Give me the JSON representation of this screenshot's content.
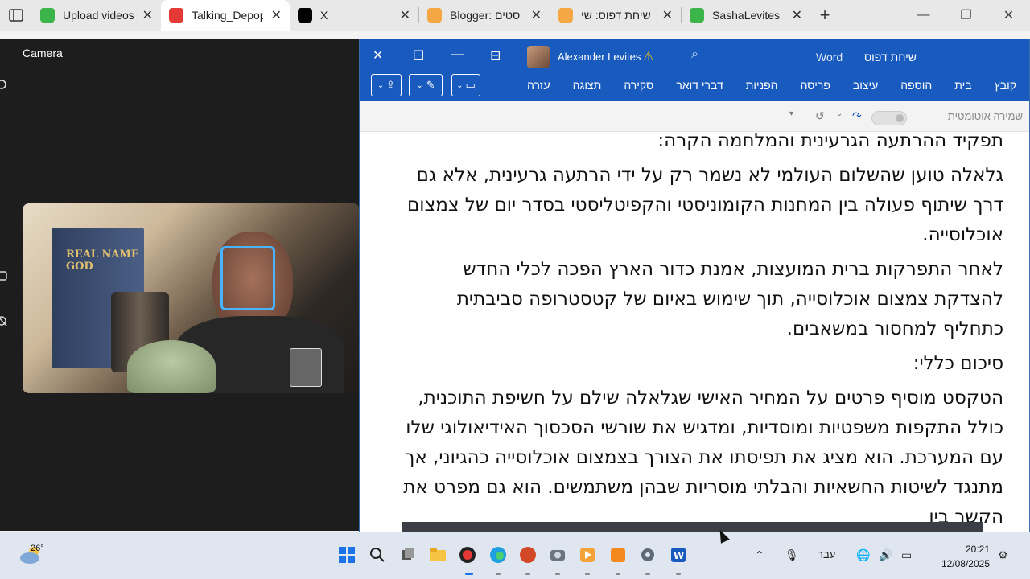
{
  "browser": {
    "tabs": [
      {
        "label": "Upload videos",
        "color": "#3bb54a"
      },
      {
        "label": "Talking_Depop",
        "color": "#e53935"
      },
      {
        "label": "X",
        "color": "#000000"
      },
      {
        "label": "Blogger: סטים",
        "color": "#f4a742"
      },
      {
        "label": "שיחת דפוס: שי",
        "color": "#f4a742"
      },
      {
        "label": "SashaLevites",
        "color": "#3bb54a"
      }
    ],
    "new_tab_label": "+"
  },
  "camera": {
    "title": "Camera",
    "book_text": "REAL NAME GOD"
  },
  "word": {
    "user_name": "Alexander Levites",
    "app_name": "Word",
    "doc_title": "שיחת דפוס",
    "ribbon_tabs": [
      "קובץ",
      "בית",
      "הוספה",
      "עיצוב",
      "פריסה",
      "הפניות",
      "דברי דואר",
      "סקירה",
      "תצוגה",
      "עזרה"
    ],
    "autosave_label": "שמירה אוטומטית",
    "document": {
      "paragraphs": [
        "תפקיד ההרתעה הגרעינית והמלחמה הקרה:",
        "גלאלה טוען שהשלום העולמי לא נשמר רק על ידי הרתעה גרעינית, אלא גם דרך שיתוף פעולה בין המחנות הקומוניסטי והקפיטליסטי בסדר יום של צמצום אוכלוסייה.",
        "לאחר התפרקות ברית המועצות, אמנת כדור הארץ הפכה לכלי החדש להצדקת צמצום אוכלוסייה, תוך שימוש באיום של קטסטרופה סביבתית כתחליף למחסור במשאבים.",
        "סיכום כללי:",
        "הטקסט מוסיף פרטים על המחיר האישי שגלאלה שילם על חשיפת התוכנית, כולל התקפות משפטיות ומוסדיות, ומדגיש את שורשי הסכסוך האידיאולוגי שלו עם המערכת. הוא מציג את תפיסתו את הצורך בצמצום אוכלוסייה כהגיוני, אך מתנגד לשיטות החשאיות והבלתי מוסריות שבהן משתמשים. הוא גם מפרט את הקשר בין"
      ]
    }
  },
  "taskbar": {
    "temperature": "26°",
    "language": "עבר",
    "time": "20:21",
    "date": "12/08/2025"
  }
}
